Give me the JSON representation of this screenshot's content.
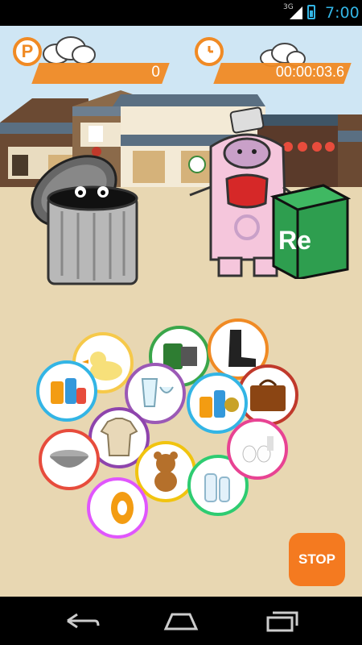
{
  "status_bar": {
    "network": "3G",
    "time": "7:00"
  },
  "hud": {
    "points": {
      "icon": "P",
      "value": "0"
    },
    "timer": {
      "value": "00:00:03.6"
    }
  },
  "recycle_box": {
    "label": "Re"
  },
  "stop_button": {
    "label": "STOP"
  },
  "colors": {
    "accent_orange": "#f08a24",
    "stop_orange": "#f47a20",
    "monster_pink": "#f5c6dc",
    "box_green": "#2e9e4f"
  },
  "items": [
    {
      "name": "rubber-duck",
      "icon": "duck-icon",
      "border": "#f6c94a"
    },
    {
      "name": "film-roll",
      "icon": "film-icon",
      "border": "#3aa64a"
    },
    {
      "name": "rubber-boot",
      "icon": "boot-icon",
      "border": "#f08a24"
    },
    {
      "name": "leather-bag",
      "icon": "bag-icon",
      "border": "#c0392b"
    },
    {
      "name": "cans",
      "icon": "cans-icon",
      "border": "#33b5e5"
    },
    {
      "name": "glasses",
      "icon": "glass-icon",
      "border": "#9b59b6"
    },
    {
      "name": "shirt",
      "icon": "shirt-icon",
      "border": "#8e44ad"
    },
    {
      "name": "pots",
      "icon": "pot-icon",
      "border": "#e74c3c"
    },
    {
      "name": "teddy-bear",
      "icon": "bear-icon",
      "border": "#f1c40f"
    },
    {
      "name": "plastic-bottles",
      "icon": "bottle-icon",
      "border": "#2ecc71"
    },
    {
      "name": "egg-carton",
      "icon": "eggs-icon",
      "border": "#e84393"
    },
    {
      "name": "tape-roll",
      "icon": "tape-icon",
      "border": "#e056fd"
    }
  ]
}
